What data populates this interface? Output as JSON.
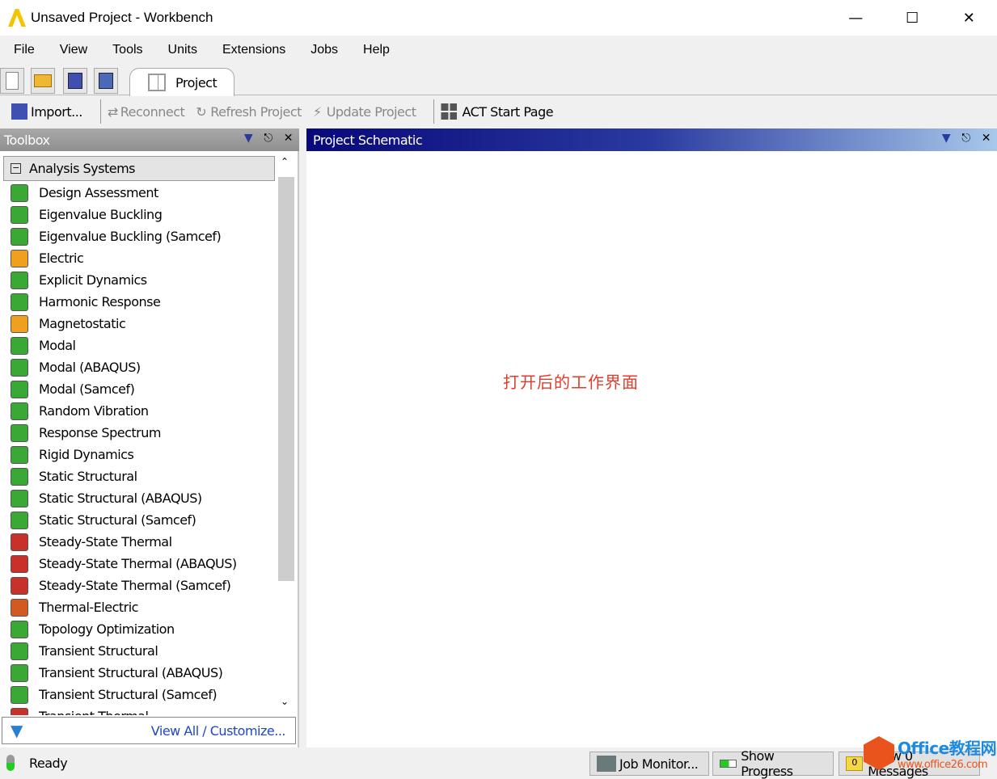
{
  "window": {
    "title": "Unsaved Project - Workbench"
  },
  "menu": [
    "File",
    "View",
    "Tools",
    "Units",
    "Extensions",
    "Jobs",
    "Help"
  ],
  "tabs": [
    {
      "label": "Project"
    }
  ],
  "toolbar": {
    "import": "Import...",
    "reconnect": "Reconnect",
    "refresh": "Refresh Project",
    "update": "Update Project",
    "act": "ACT Start Page"
  },
  "toolbox": {
    "title": "Toolbox",
    "group": "Analysis Systems",
    "footer_link": "View All / Customize...",
    "items": [
      {
        "label": "Design Assessment",
        "color": "#3aa835"
      },
      {
        "label": "Eigenvalue Buckling",
        "color": "#3aa835"
      },
      {
        "label": "Eigenvalue Buckling (Samcef)",
        "color": "#3aa835"
      },
      {
        "label": "Electric",
        "color": "#f0a020"
      },
      {
        "label": "Explicit Dynamics",
        "color": "#3aa835"
      },
      {
        "label": "Harmonic Response",
        "color": "#3aa835"
      },
      {
        "label": "Magnetostatic",
        "color": "#f0a020"
      },
      {
        "label": "Modal",
        "color": "#3aa835"
      },
      {
        "label": "Modal (ABAQUS)",
        "color": "#3aa835"
      },
      {
        "label": "Modal (Samcef)",
        "color": "#3aa835"
      },
      {
        "label": "Random Vibration",
        "color": "#3aa835"
      },
      {
        "label": "Response Spectrum",
        "color": "#3aa835"
      },
      {
        "label": "Rigid Dynamics",
        "color": "#3aa835"
      },
      {
        "label": "Static Structural",
        "color": "#3aa835"
      },
      {
        "label": "Static Structural (ABAQUS)",
        "color": "#3aa835"
      },
      {
        "label": "Static Structural (Samcef)",
        "color": "#3aa835"
      },
      {
        "label": "Steady-State Thermal",
        "color": "#c8302a"
      },
      {
        "label": "Steady-State Thermal (ABAQUS)",
        "color": "#c8302a"
      },
      {
        "label": "Steady-State Thermal (Samcef)",
        "color": "#c8302a"
      },
      {
        "label": "Thermal-Electric",
        "color": "#d05a20"
      },
      {
        "label": "Topology Optimization",
        "color": "#3aa835"
      },
      {
        "label": "Transient Structural",
        "color": "#3aa835"
      },
      {
        "label": "Transient Structural (ABAQUS)",
        "color": "#3aa835"
      },
      {
        "label": "Transient Structural (Samcef)",
        "color": "#3aa835"
      },
      {
        "label": "Transient Thermal",
        "color": "#c8302a"
      }
    ]
  },
  "schematic": {
    "title": "Project Schematic",
    "annotation": "打开后的工作界面"
  },
  "status": {
    "text": "Ready",
    "job_monitor": "Job Monitor...",
    "show_progress": "Show Progress",
    "messages": "Show 0 Messages",
    "message_count": "0"
  },
  "watermark": {
    "brand": "Office教程网",
    "url": "www.office26.com"
  }
}
